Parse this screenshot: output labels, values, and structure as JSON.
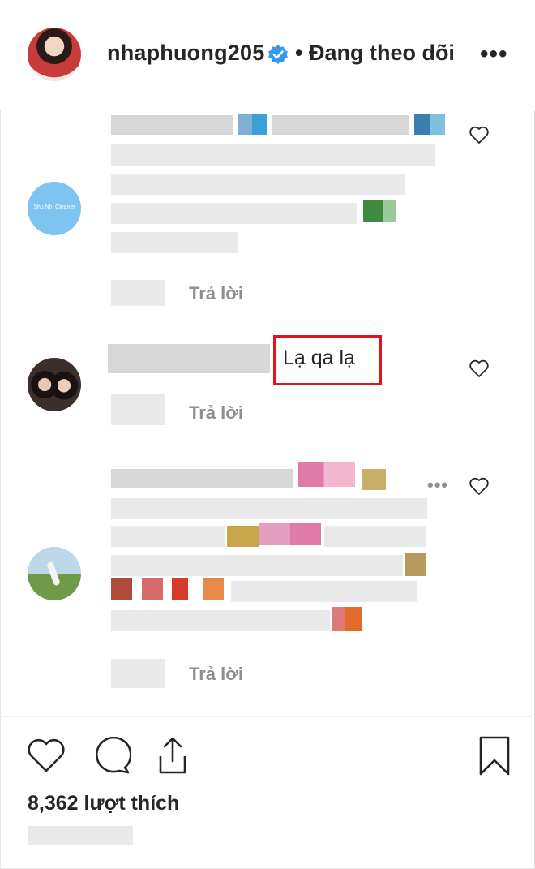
{
  "post": {
    "username": "nhaphuong205",
    "follow_status": "• Đang theo dõi",
    "more_label": "•••"
  },
  "comments": [
    {
      "reply_label": "Trả lời"
    },
    {
      "text": "Lạ qa lạ",
      "reply_label": "Trả lời"
    },
    {
      "reply_label": "Trả lời",
      "more_label": "•••"
    }
  ],
  "avatar1_text": "Shu Nhi Cleaner",
  "footer": {
    "likes": "8,362 lượt thích"
  },
  "colors": {
    "highlight": "#e0141b",
    "verified": "#3897f0",
    "muted": "#8e8e8e"
  },
  "icons": [
    "heart-icon",
    "comment-icon",
    "share-icon",
    "bookmark-icon",
    "verified-badge-icon",
    "more-options-icon"
  ]
}
